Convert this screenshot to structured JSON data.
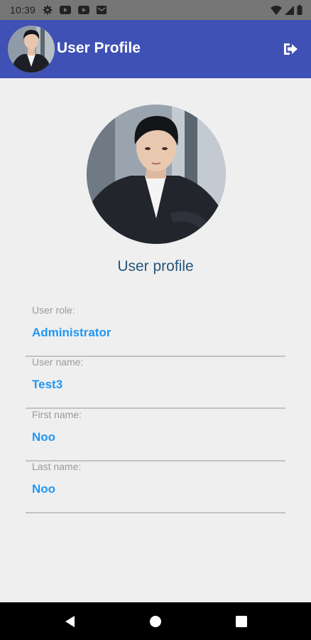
{
  "status_bar": {
    "time": "10:39",
    "icons": [
      "settings-icon",
      "youtube-icon",
      "youtube-icon",
      "mail-icon",
      "wifi-icon",
      "signal-icon",
      "battery-icon"
    ]
  },
  "app_bar": {
    "title": "User Profile",
    "background": "#3f51b5",
    "logout_icon": "logout-icon"
  },
  "profile": {
    "heading": "User profile",
    "fields": [
      {
        "label": "User role:",
        "value": "Administrator"
      },
      {
        "label": "User name:",
        "value": "Test3"
      },
      {
        "label": "First name:",
        "value": "Noo"
      },
      {
        "label": "Last name:",
        "value": "Noo"
      }
    ]
  },
  "colors": {
    "accent": "#2196f3",
    "heading": "#24567d",
    "label": "#9a9a9a"
  },
  "nav_bar": {
    "buttons": [
      "back-icon",
      "home-icon",
      "recents-icon"
    ]
  }
}
